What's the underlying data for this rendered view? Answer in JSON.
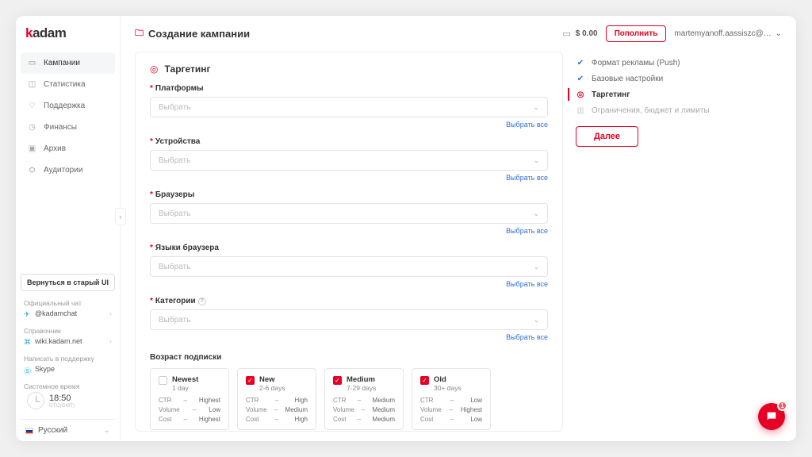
{
  "logo": {
    "text_prefix": "k",
    "text_rest": "adam",
    "tagline": "───────"
  },
  "nav": [
    {
      "label": "Кампании",
      "icon": "folder-icon",
      "active": true
    },
    {
      "label": "Статистика",
      "icon": "stats-icon"
    },
    {
      "label": "Поддержка",
      "icon": "support-icon"
    },
    {
      "label": "Финансы",
      "icon": "finance-icon"
    },
    {
      "label": "Архив",
      "icon": "archive-icon"
    },
    {
      "label": "Аудитории",
      "icon": "audience-icon"
    }
  ],
  "sidebar": {
    "old_ui": "Вернуться в старый UI",
    "chat": {
      "label": "Официальный чат",
      "link": "@kadamchat"
    },
    "wiki": {
      "label": "Справочник",
      "link": "wiki.kadam.net"
    },
    "support": {
      "label": "Написать в поддержку",
      "link": "Skype"
    },
    "time": {
      "label": "Системное время",
      "value": "18:50",
      "tz": "UTC(GMT)"
    },
    "lang": "Русский"
  },
  "header": {
    "breadcrumb": "Создание кампании",
    "balance": "$ 0.00",
    "refill": "Пополнить",
    "user": "martemyanoff.aassiszc@…"
  },
  "panel": {
    "title": "Таргетинг",
    "fields": {
      "platforms": "Платформы",
      "devices": "Устройства",
      "browsers": "Браузеры",
      "langs": "Языки браузера",
      "categories": "Категории"
    },
    "placeholder": "Выбрать",
    "select_all": "Выбрать все"
  },
  "age": {
    "label": "Возраст подписки",
    "metrics": {
      "ctr": "CTR",
      "vol": "Volume",
      "cost": "Cost"
    },
    "cards": [
      {
        "title": "Newest",
        "sub": "1 day",
        "ctr": "Highest",
        "vol": "Low",
        "cost": "Highest",
        "checked": false
      },
      {
        "title": "New",
        "sub": "2-6 days",
        "ctr": "High",
        "vol": "Medium",
        "cost": "High",
        "checked": true
      },
      {
        "title": "Medium",
        "sub": "7-29 days",
        "ctr": "Medium",
        "vol": "Medium",
        "cost": "Medium",
        "checked": true
      },
      {
        "title": "Old",
        "sub": "30+ days",
        "ctr": "Low",
        "vol": "Highest",
        "cost": "Low",
        "checked": true
      }
    ]
  },
  "steps": {
    "items": [
      {
        "label": "Формат рекламы (Push)",
        "state": "done"
      },
      {
        "label": "Базовые настройки",
        "state": "done"
      },
      {
        "label": "Таргетинг",
        "state": "active"
      },
      {
        "label": "Ограничения, бюджет и лимиты",
        "state": "pending"
      }
    ],
    "next": "Далее"
  },
  "chat_badge": "1"
}
